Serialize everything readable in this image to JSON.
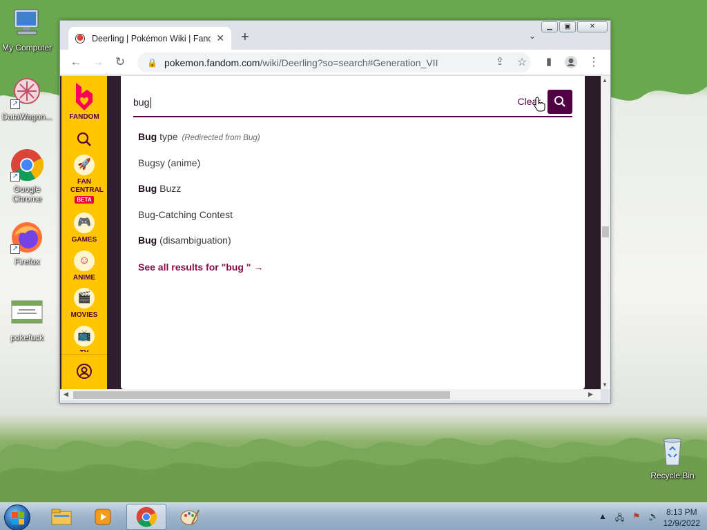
{
  "desktop": {
    "icons": [
      {
        "label": "My Computer"
      },
      {
        "label": "DataWagon..."
      },
      {
        "label": "Google Chrome"
      },
      {
        "label": "Firefox"
      },
      {
        "label": "pokefuck"
      },
      {
        "label": "Recycle Bin"
      }
    ]
  },
  "browser": {
    "tab_title": "Deerling | Pokémon Wiki | Fandom",
    "url_host": "pokemon.fandom.com",
    "url_path": "/wiki/Deerling?so=search#Generation_VII"
  },
  "fandom_sidebar": {
    "logo_label": "FANDOM",
    "items": [
      {
        "label": "FAN CENTRAL",
        "badge": "BETA"
      },
      {
        "label": "GAMES"
      },
      {
        "label": "ANIME"
      },
      {
        "label": "MOVIES"
      },
      {
        "label": "TV"
      }
    ]
  },
  "search": {
    "query": "bug",
    "clear_label": "Clear",
    "results": [
      {
        "bold": "Bug",
        "rest": " type",
        "note": "(Redirected from Bug)"
      },
      {
        "bold": "",
        "rest": "Bugsy (anime)",
        "note": ""
      },
      {
        "bold": "Bug",
        "rest": " Buzz",
        "note": ""
      },
      {
        "bold": "",
        "rest": "Bug-Catching Contest",
        "note": ""
      },
      {
        "bold": "Bug",
        "rest": " (disambiguation)",
        "note": ""
      }
    ],
    "see_all": "See all results for \"bug \" →"
  },
  "taskbar": {
    "time": "8:13 PM",
    "date": "12/9/2022"
  },
  "colors": {
    "fandom_yellow": "#ffc500",
    "fandom_purple": "#520044",
    "see_all_link": "#8a0a4a"
  }
}
